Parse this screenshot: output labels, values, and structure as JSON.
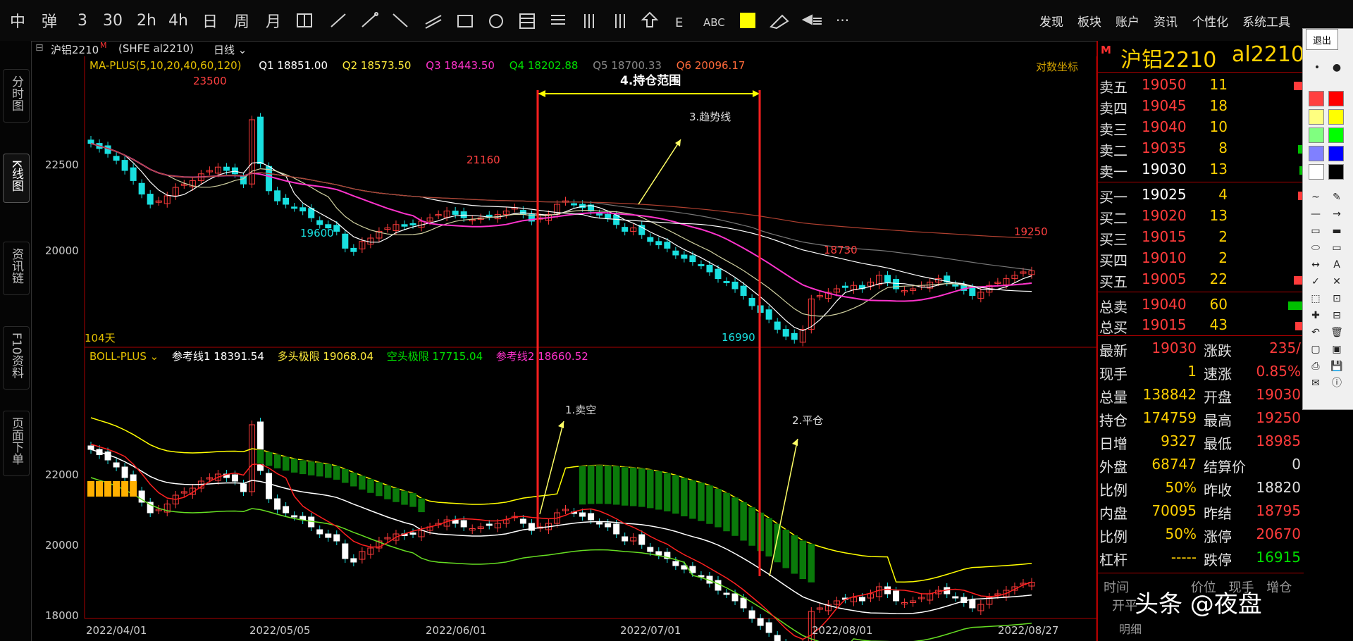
{
  "toolbar": {
    "left_items": [
      "中",
      "弹",
      "3",
      "30",
      "2h",
      "4h",
      "日",
      "周",
      "月"
    ],
    "menu": [
      "发现",
      "板块",
      "账户",
      "资讯",
      "个性化",
      "系统工具"
    ],
    "exit_label": "退出",
    "abc_label": "ABC"
  },
  "left_tabs": [
    "分时图",
    "K线图",
    "资讯链",
    "F10资料",
    "页面下单"
  ],
  "chart": {
    "title": "沪铝2210",
    "title_code": "(SHFE al2210)",
    "period": "日线",
    "ma_label": "MA-PLUS(5,10,20,40,60,120)",
    "q1": "Q1 18851.00",
    "q2": "Q2 18573.50",
    "q3": "Q3 18443.50",
    "q4": "Q4 18202.88",
    "q5": "Q5 18700.33",
    "q6": "Q6 20096.17",
    "log_axis": "对数坐标",
    "days": "104天",
    "boll_label": "BOLL-PLUS",
    "boll_ref1": "参考线1 18391.54",
    "boll_long": "多头极限 19068.04",
    "boll_short": "空头极限 17715.04",
    "boll_ref2": "参考线2 18660.52",
    "annot_range": "4.持仓范围",
    "annot_trend": "3.趋势线",
    "annot_sell": "1.卖空",
    "annot_close": "2.平仓",
    "price_high": "23500",
    "price_21160": "21160",
    "price_19600": "19600",
    "price_18730": "18730",
    "price_19250": "19250",
    "price_low": "16990",
    "y_main": [
      "22500",
      "20000"
    ],
    "y_boll": [
      "22000",
      "20000",
      "18000"
    ],
    "x_dates": [
      "2022/04/01",
      "2022/05/05",
      "2022/06/01",
      "2022/07/01",
      "2022/08/01",
      "2022/08/27"
    ]
  },
  "quote": {
    "header_marker": "M",
    "name": "沪铝2210",
    "code": "al2210",
    "asks": [
      {
        "label": "卖五",
        "price": "19050",
        "vol": "11"
      },
      {
        "label": "卖四",
        "price": "19045",
        "vol": "18"
      },
      {
        "label": "卖三",
        "price": "19040",
        "vol": "10"
      },
      {
        "label": "卖二",
        "price": "19035",
        "vol": "8"
      },
      {
        "label": "卖一",
        "price": "19030",
        "vol": "13"
      }
    ],
    "bids": [
      {
        "label": "买一",
        "price": "19025",
        "vol": "4"
      },
      {
        "label": "买二",
        "price": "19020",
        "vol": "13"
      },
      {
        "label": "买三",
        "price": "19015",
        "vol": "2"
      },
      {
        "label": "买四",
        "price": "19010",
        "vol": "2"
      },
      {
        "label": "买五",
        "price": "19005",
        "vol": "22"
      }
    ],
    "totals": [
      {
        "label": "总卖",
        "price": "19040",
        "vol": "60"
      },
      {
        "label": "总买",
        "price": "19015",
        "vol": "43"
      }
    ],
    "stats": [
      {
        "l": "最新",
        "lv": "19030",
        "r": "涨跌",
        "rv": "235/"
      },
      {
        "l": "现手",
        "lv": "1",
        "r": "速涨",
        "rv": "0.85%"
      },
      {
        "l": "总量",
        "lv": "138842",
        "r": "开盘",
        "rv": "19030"
      },
      {
        "l": "持仓",
        "lv": "174759",
        "r": "最高",
        "rv": "19250"
      },
      {
        "l": "日增",
        "lv": "9327",
        "r": "最低",
        "rv": "18985"
      },
      {
        "l": "外盘",
        "lv": "68747",
        "r": "结算价",
        "rv": "0"
      },
      {
        "l": "比例",
        "lv": "50%",
        "r": "昨收",
        "rv": "18820"
      },
      {
        "l": "内盘",
        "lv": "70095",
        "r": "昨结",
        "rv": "18795"
      },
      {
        "l": "比例",
        "lv": "50%",
        "r": "涨停",
        "rv": "20670"
      },
      {
        "l": "杠杆",
        "lv": "-----",
        "r": "跌停",
        "rv": "16915"
      }
    ],
    "bottom_tabs": [
      "时间",
      "价位",
      "现手",
      "增仓",
      "开平"
    ],
    "bottom_label": "明细"
  },
  "watermark": "头条 @夜盘",
  "colors": {
    "up": "#ff3b3b",
    "down": "#19e0e0",
    "yellow": "#ffff00",
    "green": "#00c000",
    "magenta": "#ff33cc"
  }
}
